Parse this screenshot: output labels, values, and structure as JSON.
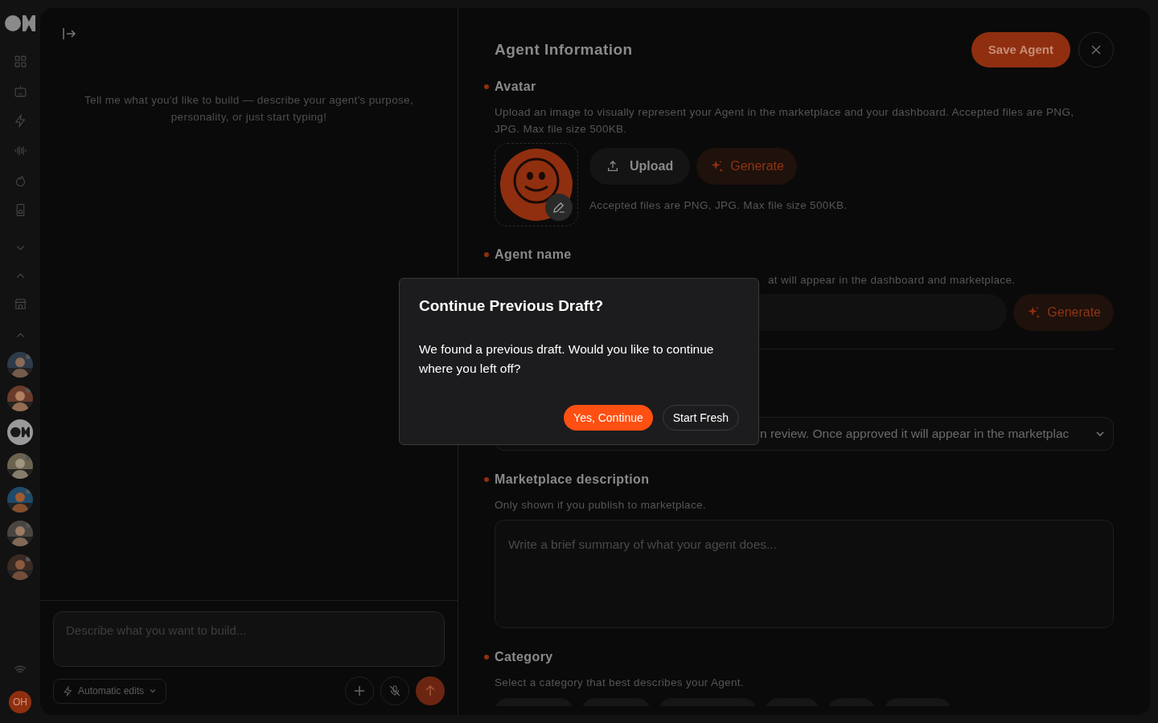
{
  "rail": {
    "nav": [
      {
        "kind": "grid"
      },
      {
        "kind": "robot"
      },
      {
        "kind": "bolt"
      },
      {
        "kind": "wave"
      },
      {
        "kind": "flame"
      },
      {
        "kind": "speaker"
      },
      {
        "kind": "chevron-down"
      },
      {
        "kind": "chevron-up"
      },
      {
        "kind": "store"
      },
      {
        "kind": "chevron-up"
      }
    ],
    "agents": [
      {
        "kind": "picture"
      },
      {
        "kind": "picture"
      },
      {
        "kind": "logo"
      },
      {
        "kind": "picture"
      },
      {
        "kind": "picture"
      },
      {
        "kind": "picture"
      },
      {
        "kind": "picture"
      }
    ],
    "user": {
      "initials": "OH"
    }
  },
  "chat": {
    "hint": "Tell me what you'd like to build — describe your agent's purpose, personality, or just start typing!",
    "input": {
      "placeholder": "Describe what you want to build..."
    },
    "mode": "Automatic edits"
  },
  "form": {
    "title": "Agent Information",
    "save": "Save Agent",
    "avatar": {
      "label": "Avatar",
      "description": "Upload an image to visually represent your Agent in the marketplace and your dashboard. Accepted files are PNG, JPG. Max file size 500KB.",
      "upload": "Upload",
      "generate": "Generate",
      "note": "Accepted files are PNG, JPG. Max file size 500KB."
    },
    "name": {
      "label": "Agent name",
      "description": "at will appear in the dashboard and marketplace.",
      "generate": "Generate"
    },
    "visibility": {
      "value": "n review. Once approved it will appear in the marketplac"
    },
    "marketplace": {
      "label": "Marketplace description",
      "description": "Only shown if you publish to marketplace.",
      "placeholder": "Write a brief summary of what your agent does..."
    },
    "category": {
      "label": "Category",
      "description": "Select a category that best describes your Agent."
    }
  },
  "dialog": {
    "title": "Continue Previous Draft?",
    "message": "We found a previous draft. Would you like to continue where you left off?",
    "buttons": [
      {
        "label": "Yes, Continue",
        "primary": true
      },
      {
        "label": "Start Fresh",
        "primary": false
      }
    ]
  }
}
